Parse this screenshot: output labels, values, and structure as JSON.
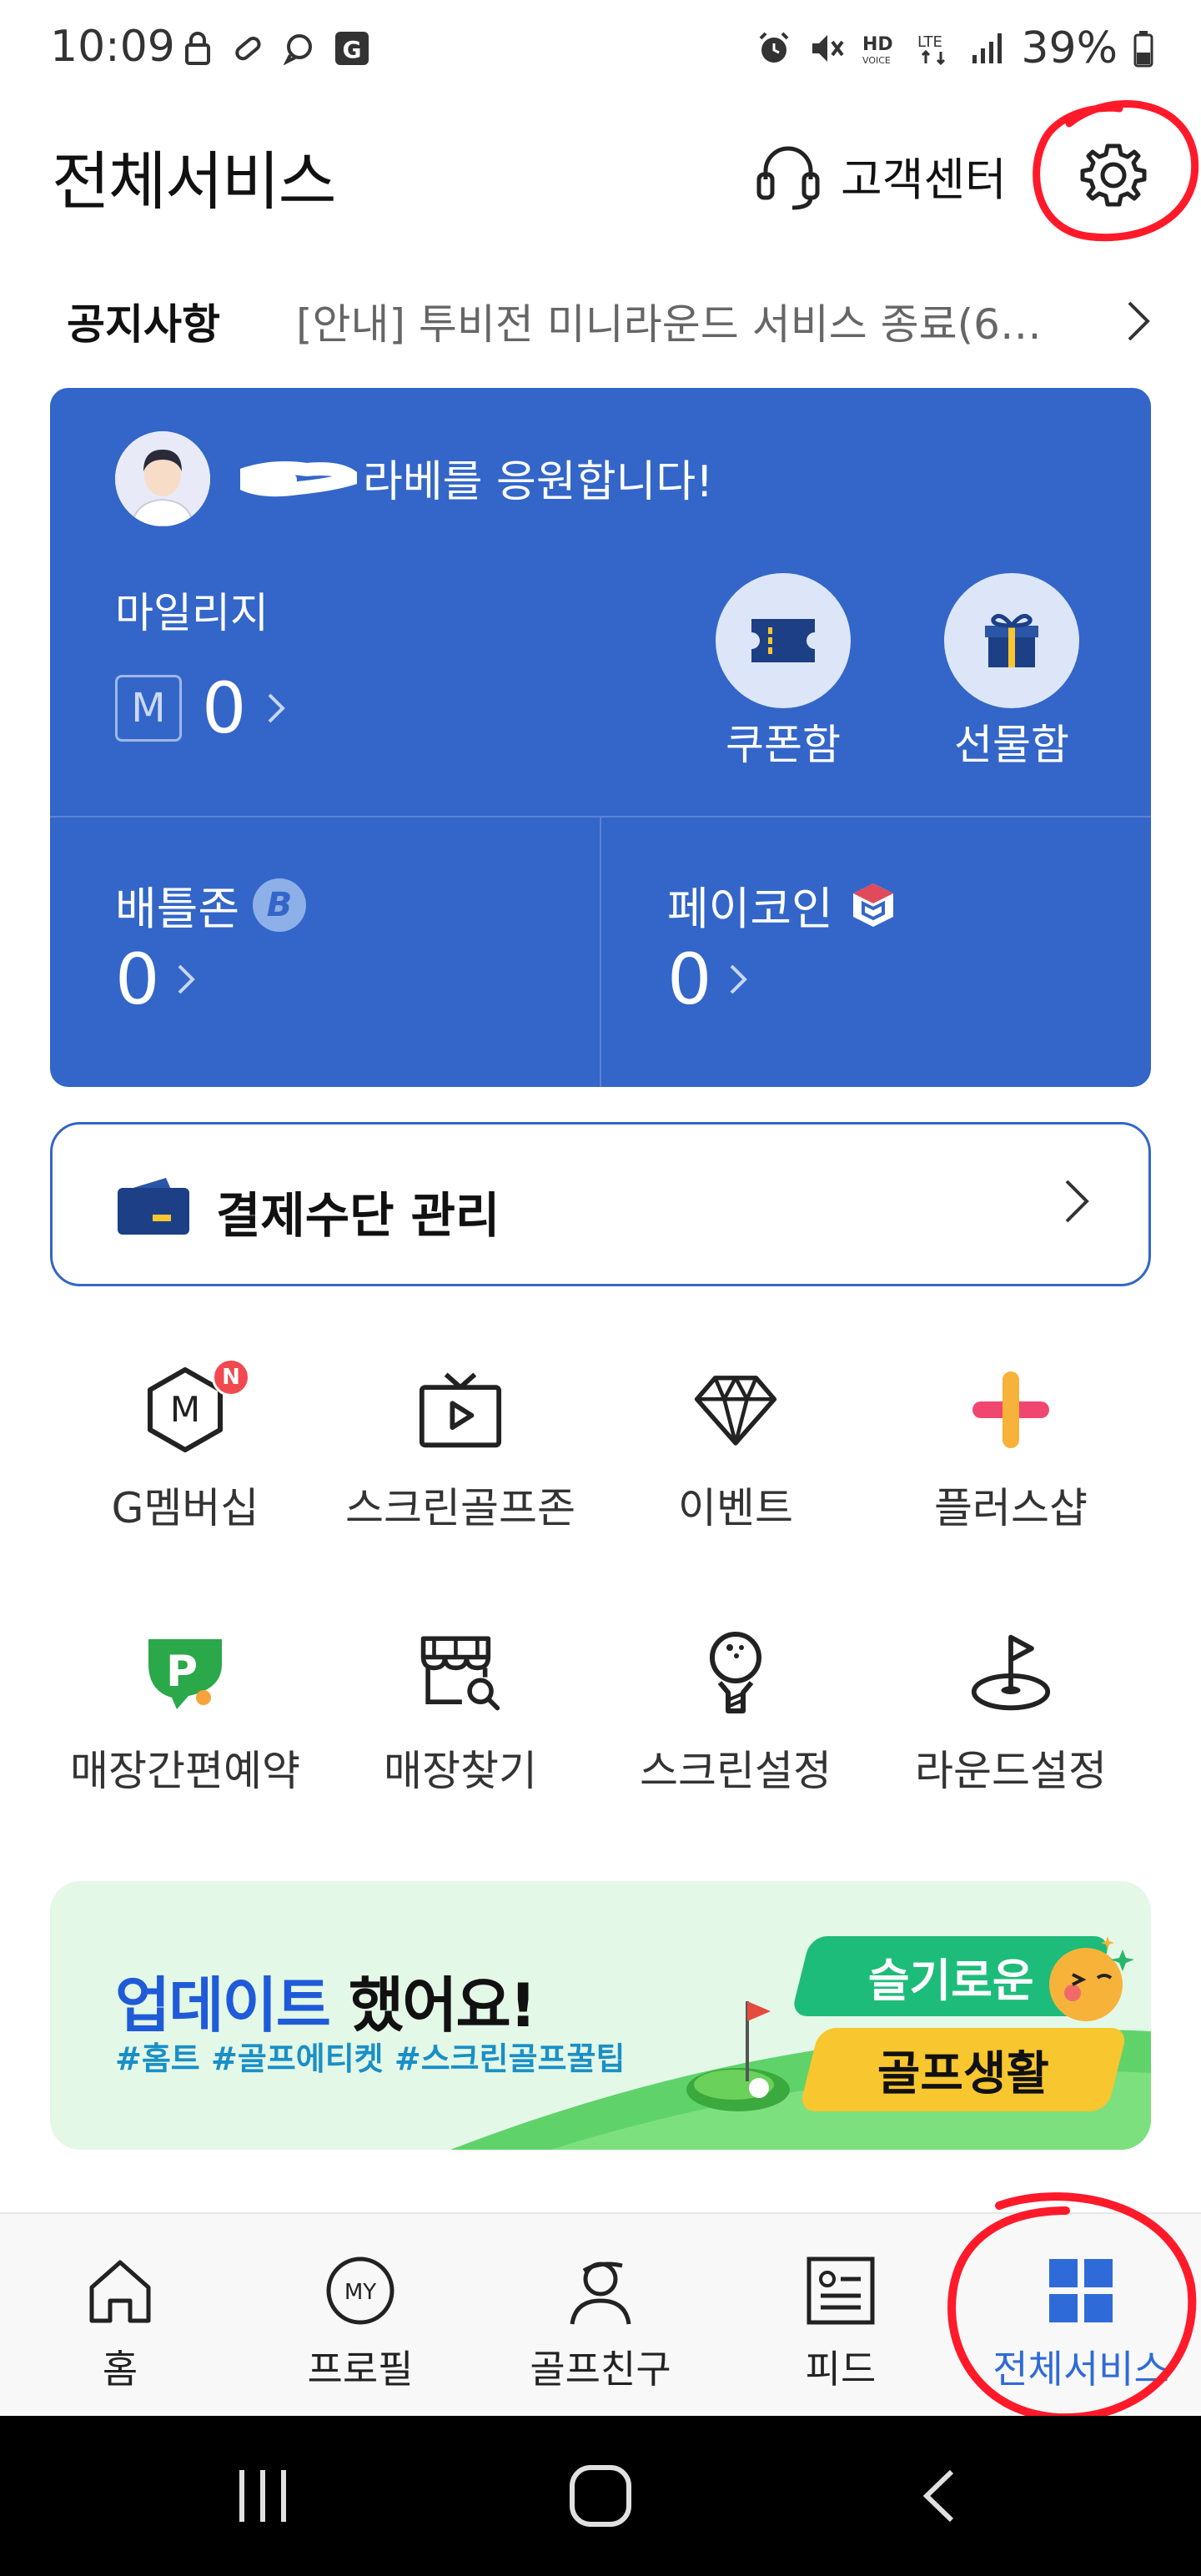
{
  "status_bar": {
    "time": "10:09",
    "battery": "39%",
    "network": "LTE"
  },
  "header": {
    "title": "전체서비스",
    "customer_center": "고객센터"
  },
  "notice": {
    "label": "공지사항",
    "text": "[안내] 투비전 미니라운드 서비스 종료(6…"
  },
  "profile_card": {
    "greeting": "라베를 응원합니다!",
    "mileage_label": "마일리지",
    "mileage_badge": "M",
    "mileage_value": "0",
    "coupon_label": "쿠폰함",
    "gift_label": "선물함",
    "battlezone_label": "배틀존",
    "battlezone_badge": "B",
    "battlezone_value": "0",
    "paycoin_label": "페이코인",
    "paycoin_value": "0",
    "accent_color": "#3366c8"
  },
  "payment": {
    "label": "결제수단 관리"
  },
  "menu": {
    "row1": [
      {
        "label": "G멤버십",
        "icon": "membership-m-hex-icon",
        "badge": "N"
      },
      {
        "label": "스크린골프존",
        "icon": "tv-play-icon"
      },
      {
        "label": "이벤트",
        "icon": "diamond-icon"
      },
      {
        "label": "플러스샵",
        "icon": "plus-icon"
      }
    ],
    "row2": [
      {
        "label": "매장간편예약",
        "icon": "p-booking-icon"
      },
      {
        "label": "매장찾기",
        "icon": "store-search-icon"
      },
      {
        "label": "스크린설정",
        "icon": "golf-ball-tee-icon"
      },
      {
        "label": "라운드설정",
        "icon": "golf-flag-hole-icon"
      }
    ]
  },
  "banner": {
    "title_part1": "업데이트",
    "title_part2": " 했어요!",
    "tags": "#홈트  #골프에티켓  #스크린골프꿀팁",
    "pill_top": "슬기로운",
    "pill_bottom": "골프생활"
  },
  "bottom_nav": {
    "items": [
      {
        "label": "홈",
        "icon": "home-icon"
      },
      {
        "label": "프로필",
        "icon": "my-profile-icon"
      },
      {
        "label": "골프친구",
        "icon": "golf-friend-icon"
      },
      {
        "label": "피드",
        "icon": "feed-icon"
      },
      {
        "label": "전체서비스",
        "icon": "grid-icon",
        "active": true
      }
    ],
    "active_color": "#2f6bd8"
  }
}
